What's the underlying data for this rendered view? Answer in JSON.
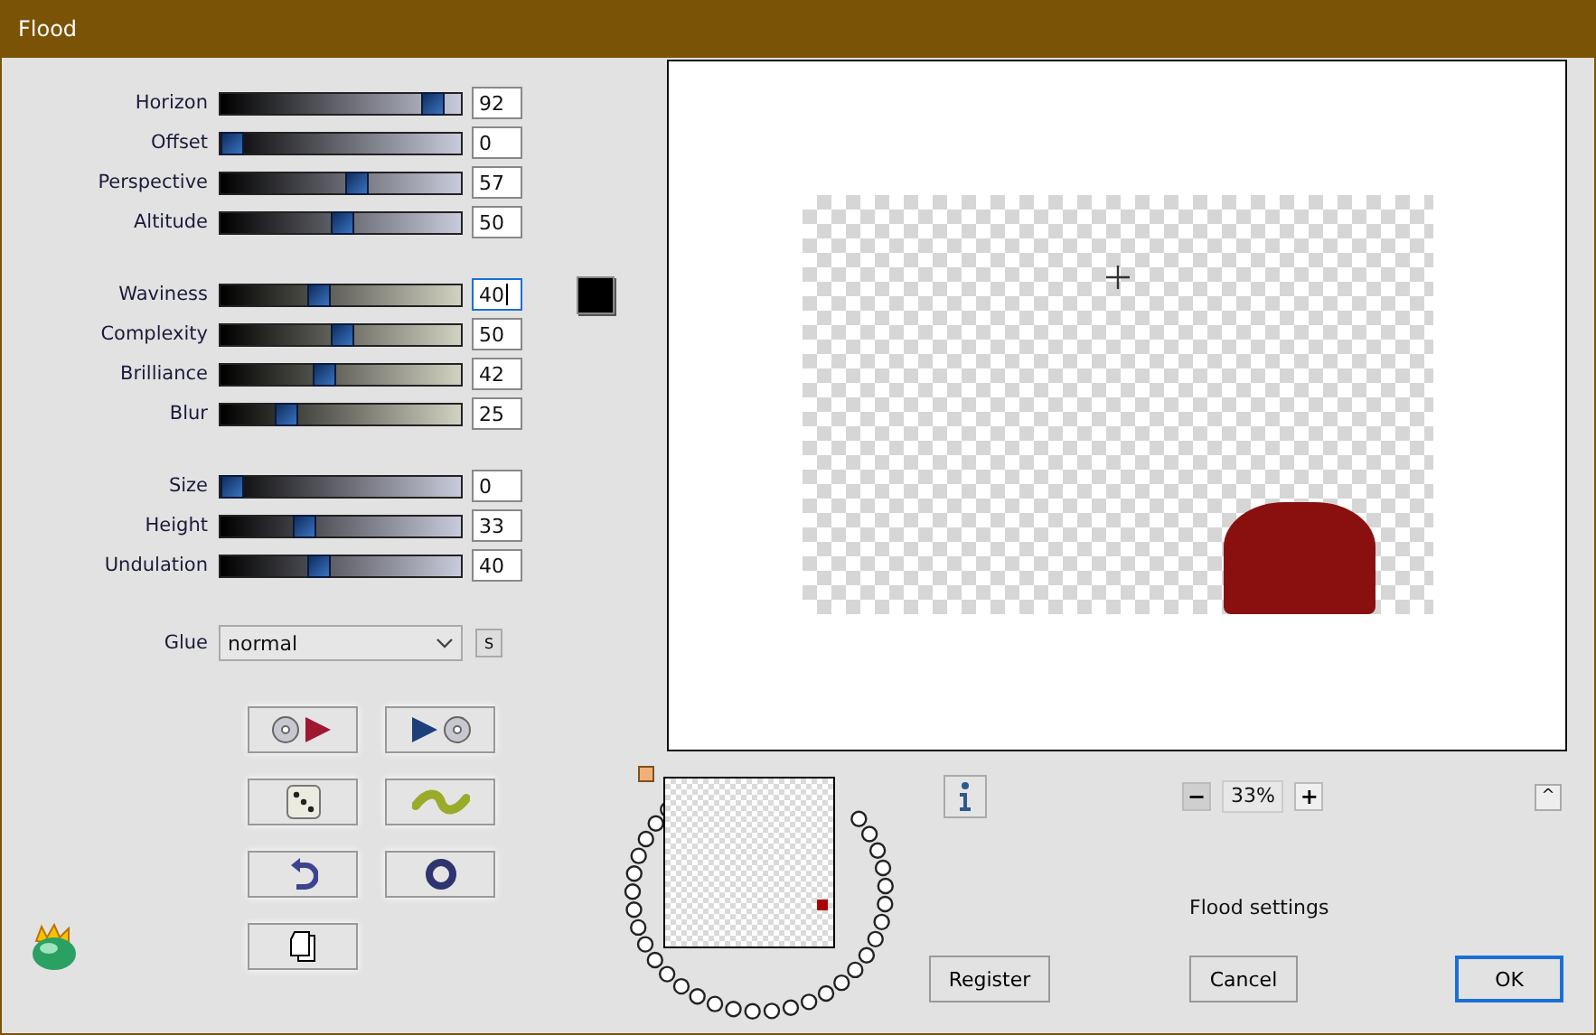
{
  "window": {
    "title": "Flood"
  },
  "slider_groups": [
    {
      "sliders": [
        {
          "label": "Horizon",
          "value": "92",
          "level": 0.92
        },
        {
          "label": "Offset",
          "value": "0",
          "level": 0
        },
        {
          "label": "Perspective",
          "value": "57",
          "level": 0.57
        },
        {
          "label": "Altitude",
          "value": "50",
          "level": 0.5
        }
      ]
    },
    {
      "sliders": [
        {
          "label": "Waviness",
          "value": "40",
          "level": 0.4,
          "focused": true
        },
        {
          "label": "Complexity",
          "value": "50",
          "level": 0.5,
          "focused": false
        },
        {
          "label": "Brilliance",
          "value": "42",
          "level": 0.42,
          "focused": false
        },
        {
          "label": "Blur",
          "value": "25",
          "level": 0.25,
          "focused": false
        }
      ]
    },
    {
      "sliders": [
        {
          "label": "Size",
          "value": "0",
          "level": 0
        },
        {
          "label": "Height",
          "value": "33",
          "level": 0.33
        },
        {
          "label": "Undulation",
          "value": "40",
          "level": 0.4
        }
      ]
    }
  ],
  "color_swatch": {
    "color": "#000000"
  },
  "glue": {
    "label": "Glue",
    "value": "normal",
    "side_button": "S"
  },
  "zoom": {
    "value": "33%",
    "minus": "−",
    "plus": "+"
  },
  "collapse_button": "^",
  "status": "Flood settings",
  "buttons": [
    {
      "label": "Register",
      "default": false
    },
    {
      "label": "Cancel",
      "default": false
    },
    {
      "label": "OK",
      "default": true
    }
  ]
}
